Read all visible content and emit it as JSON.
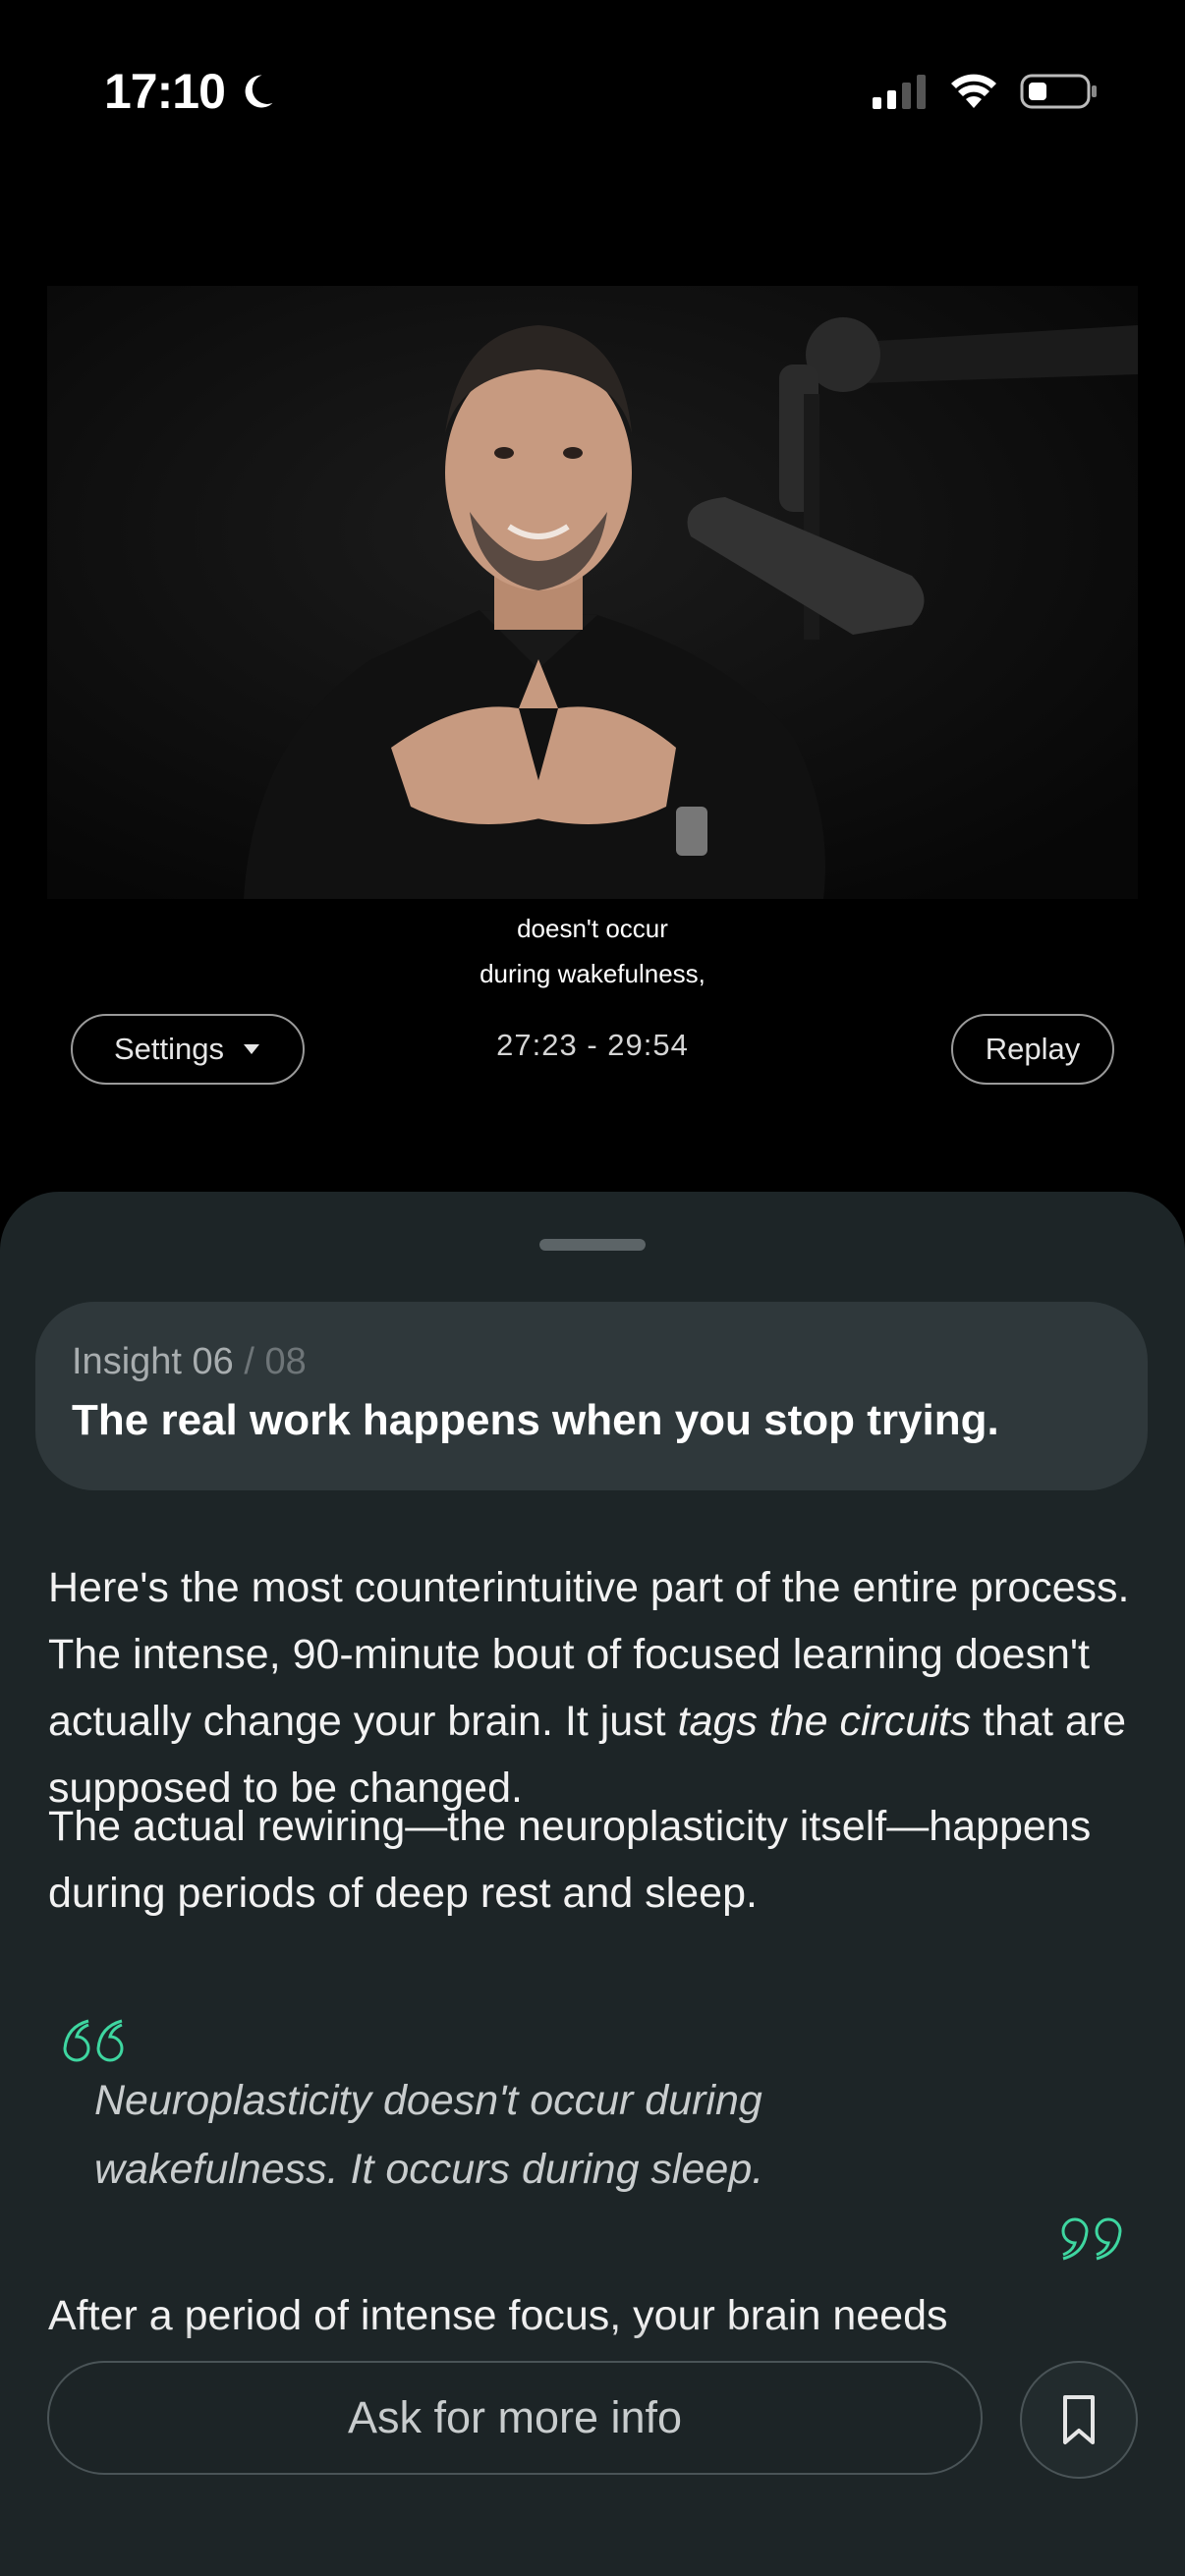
{
  "status_bar": {
    "time": "17:10",
    "icons": [
      "moon-icon",
      "cellular-signal-icon",
      "wifi-icon",
      "battery-icon"
    ]
  },
  "video": {
    "captions": [
      "doesn't occur",
      "during wakefulness,"
    ],
    "settings_label": "Settings",
    "time_range": "27:23 - 29:54",
    "replay_label": "Replay"
  },
  "insight": {
    "label": "Insight 06",
    "total": "/ 08",
    "title": "The real work happens when you stop trying."
  },
  "content": {
    "p1_part1": "Here's the most counterintuitive part of the entire process. The intense, 90-minute bout of focused learning doesn't actually change your brain. It just ",
    "p1_em": "tags the circuits",
    "p1_part2": " that are supposed to be changed.",
    "p2": "The actual rewiring—the neuroplasticity itself—happens during periods of deep rest and sleep.",
    "quote": "Neuroplasticity doesn't occur during wakefulness. It occurs during sleep.",
    "p3": "After a period of intense focus, your brain needs"
  },
  "bottom_bar": {
    "ask_placeholder": "Ask for more info"
  },
  "colors": {
    "accent_quote": "#3ed6a0",
    "sheet_bg": "#1d2527",
    "card_bg": "#2f383b"
  }
}
